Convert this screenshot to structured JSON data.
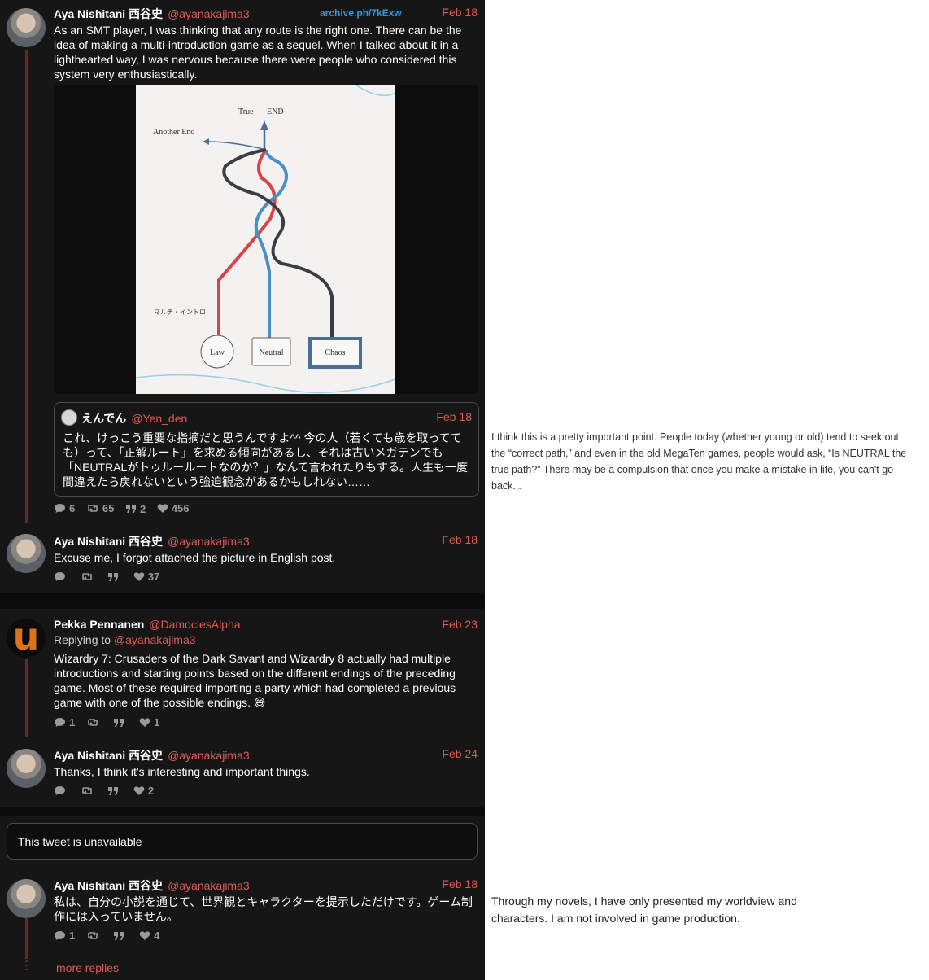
{
  "archive_link": "archive.ph/7kExw",
  "posts": [
    {
      "name": "Aya Nishitani 西谷史",
      "handle": "@ayanakajima3",
      "date": "Feb 18",
      "text": "As an SMT player, I was thinking that any route is the right one. There can be the idea of making a multi-introduction game as a sequel. When I talked about it in a lighthearted way, I was nervous because there were people who considered this system very enthusiastically.",
      "stats": {
        "replies": "6",
        "retweets": "65",
        "quotes": "2",
        "likes": "456"
      }
    },
    {
      "name": "Aya Nishitani 西谷史",
      "handle": "@ayanakajima3",
      "date": "Feb 18",
      "text": "Excuse me, I forgot attached the picture in English post.",
      "stats": {
        "replies": "",
        "retweets": "",
        "quotes": "",
        "likes": "37"
      }
    },
    {
      "name": "Pekka Pennanen",
      "handle": "@DamoclesAlpha",
      "date": "Feb 23",
      "replying_label": "Replying to",
      "replying_handle": "@ayanakajima3",
      "text": "Wizardry 7: Crusaders of the Dark Savant and Wizardry 8 actually had multiple introductions and starting points based on the different endings of the preceding game. Most of these required importing a party which had completed a previous game with one of the possible endings. 😅",
      "stats": {
        "replies": "1",
        "retweets": "",
        "quotes": "",
        "likes": "1"
      }
    },
    {
      "name": "Aya Nishitani 西谷史",
      "handle": "@ayanakajima3",
      "date": "Feb 24",
      "text": "Thanks, I think it's interesting and important things.",
      "stats": {
        "replies": "",
        "retweets": "",
        "quotes": "",
        "likes": "2"
      }
    },
    {
      "name": "Aya Nishitani 西谷史",
      "handle": "@ayanakajima3",
      "date": "Feb 18",
      "text": "私は、自分の小説を通じて、世界観とキャラクターを提示しただけです。ゲーム制作には入っていません。",
      "stats": {
        "replies": "1",
        "retweets": "",
        "quotes": "",
        "likes": "4"
      }
    }
  ],
  "drawing": {
    "true_label": "True",
    "end_label": "END",
    "another_end_label": "Another End",
    "multi_intro_label": "マルチ・イントロ",
    "law_label": "Law",
    "neutral_label": "Neutral",
    "chaos_label": "Chaos",
    "colors": {
      "law": "#d9444a",
      "neutral": "#4b8fc4",
      "chaos": "#3b3d44"
    }
  },
  "quote": {
    "name": "えんでん",
    "handle": "@Yen_den",
    "date": "Feb 18",
    "text": "これ、けっこう重要な指摘だと思うんですよ^^ 今の人（若くても歳を取ってても）って、「正解ルート」を求める傾向があるし、それは古いメガテンでも「NEUTRALがトゥルールートなのか？」なんて言われたりもする。人生も一度間違えたら戻れないという強迫観念があるかもしれない……"
  },
  "unavailable_text": "This tweet is unavailable",
  "more_replies": "more replies",
  "notes": {
    "translation1": "I think this is a pretty important point. People today (whether young or old) tend to seek out the “correct path,” and even in the old MegaTen games, people would ask, “Is NEUTRAL the true path?” There may be a compulsion that once you make a mistake in life, you can't go back...",
    "translation2": "Through my novels, I have only presented my worldview and characters. I am not involved in game production."
  }
}
